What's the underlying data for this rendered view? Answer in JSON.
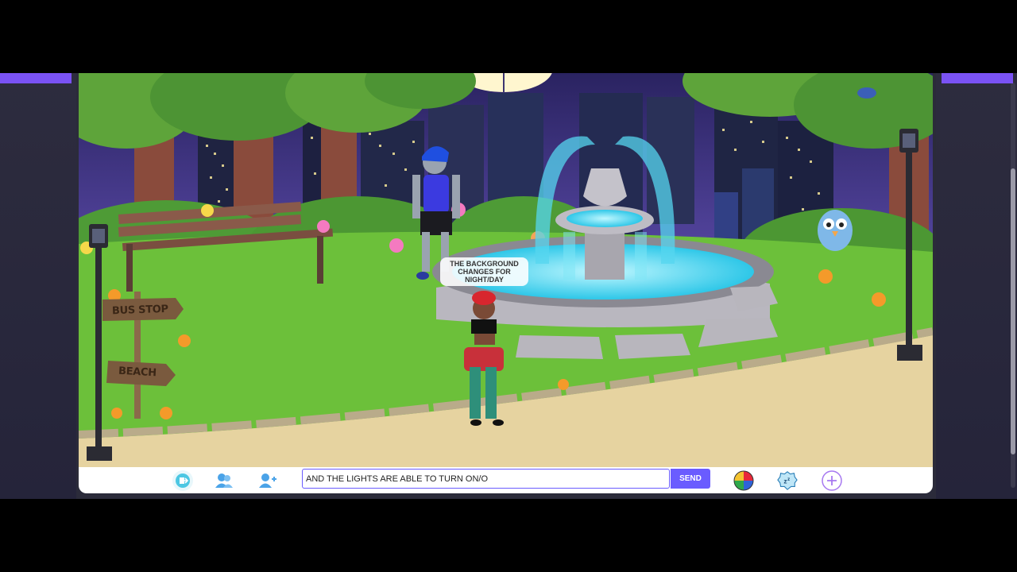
{
  "scene": {
    "speech_bubble": "THE BACKGROUND CHANGES FOR NIGHT/DAY",
    "signpost": {
      "top_label": "BUS STOP",
      "bottom_label": "BEACH"
    }
  },
  "bottom_bar": {
    "chat_input_value": "AND THE LIGHTS ARE ABLE TO TURN ON/O",
    "send_label": "SEND",
    "icons": [
      "exit-icon",
      "friends-icon",
      "add-friend-icon",
      "beach-ball-icon",
      "settings-badge-icon",
      "plus-icon"
    ]
  },
  "colors": {
    "accent": "#6a5cff",
    "top_strip": "#7a52f4",
    "sky": "#3a2f6e",
    "grass": "#6cc03a",
    "path": "#e3cf9a",
    "water": "#3fd0ec"
  }
}
